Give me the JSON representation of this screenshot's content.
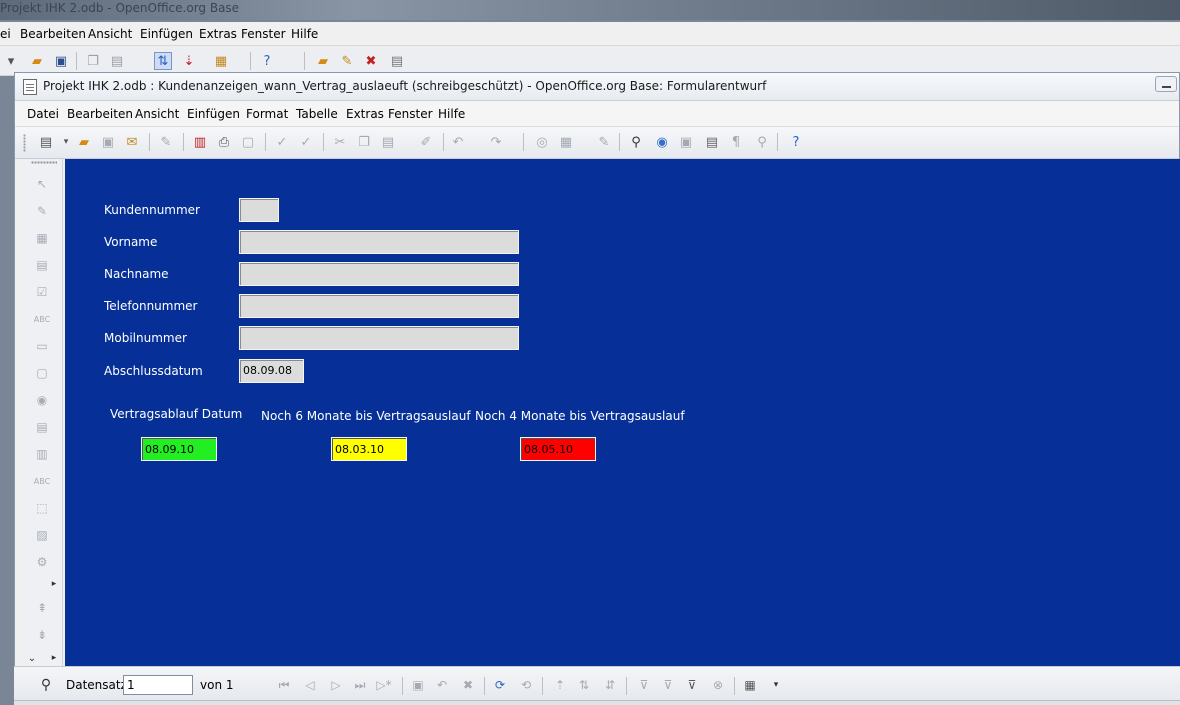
{
  "outer_window": {
    "title": "Projekt IHK 2.odb - OpenOffice.org Base",
    "menu": [
      "ei",
      "Bearbeiten",
      "Ansicht",
      "Einfügen",
      "Extras",
      "Fenster",
      "Hilfe"
    ]
  },
  "window": {
    "title": "Projekt IHK 2.odb : Kundenanzeigen_wann_Vertrag_auslaeuft (schreibgeschützt) - OpenOffice.org Base: Formularentwurf"
  },
  "menu": [
    "Datei",
    "Bearbeiten",
    "Ansicht",
    "Einfügen",
    "Format",
    "Tabelle",
    "Extras",
    "Fenster",
    "Hilfe"
  ],
  "toolbar_icons": [
    "edit-file-icon",
    "open-folder-icon",
    "save-icon",
    "send-mail-icon",
    "edit-mode-icon",
    "export-pdf-icon",
    "print-icon",
    "page-preview-icon",
    "spellcheck-icon",
    "autospell-icon",
    "cut-icon",
    "copy-icon",
    "paste-icon",
    "format-paintbrush-icon",
    "undo-icon",
    "redo-icon",
    "hyperlink-icon",
    "table-icon",
    "draw-icon",
    "find-icon",
    "navigator-icon",
    "gallery-icon",
    "data-sources-icon",
    "nonprinting-chars-icon",
    "zoom-icon",
    "help-icon"
  ],
  "form": {
    "background_color": "#063098",
    "fields": [
      {
        "label": "Kundennummer",
        "value": ""
      },
      {
        "label": "Vorname",
        "value": ""
      },
      {
        "label": "Nachname",
        "value": ""
      },
      {
        "label": "Telefonnummer",
        "value": ""
      },
      {
        "label": "Mobilnummer",
        "value": ""
      },
      {
        "label": "Abschlussdatum",
        "value": "08.09.08"
      }
    ],
    "indicators": [
      {
        "label": "Vertragsablauf Datum",
        "value": "08.09.10",
        "color": "#22ee22"
      },
      {
        "label": "Noch 6 Monate bis Vertragsauslauf",
        "value": "08.03.10",
        "color": "#ffff00"
      },
      {
        "label": "Noch 4 Monate bis Vertragsauslauf",
        "value": "08.05.10",
        "color": "#ff0000"
      }
    ]
  },
  "navigation": {
    "label": "Datensatz",
    "record": "1",
    "of_label": "von 1"
  }
}
